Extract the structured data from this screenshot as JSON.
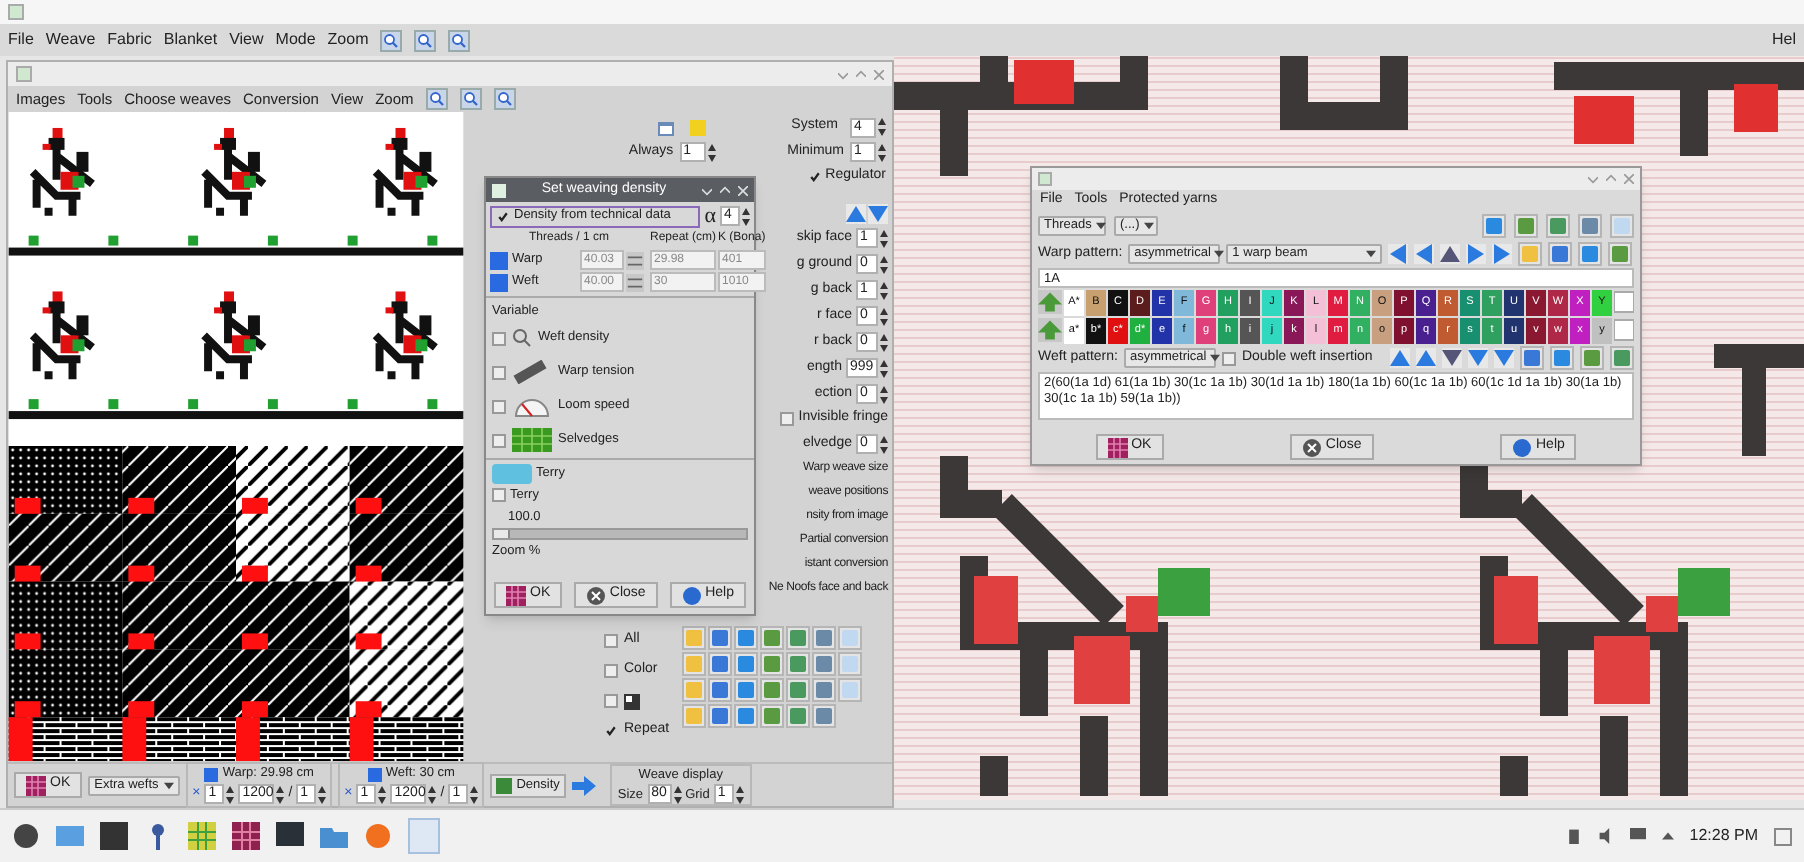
{
  "menu_bar": {
    "items": [
      "File",
      "Weave",
      "Fabric",
      "Blanket",
      "View",
      "Mode",
      "Zoom"
    ],
    "help": "Hel"
  },
  "main_window": {
    "menu": [
      "Images",
      "Tools",
      "Choose weaves",
      "Conversion",
      "View",
      "Zoom"
    ],
    "system": {
      "label": "System",
      "value": "4"
    },
    "always": {
      "label": "Always",
      "value": "1"
    },
    "minimum": {
      "label": "Minimum",
      "value": "1"
    },
    "regulator": {
      "label": "Regulator",
      "checked": true
    },
    "partial_fields": [
      {
        "label": "skip face",
        "value": "1"
      },
      {
        "label": "g ground",
        "value": "0"
      },
      {
        "label": "g back",
        "value": "1"
      },
      {
        "label": "r face",
        "value": "0"
      },
      {
        "label": "r back",
        "value": "0"
      },
      {
        "label": "ength",
        "value": "999"
      },
      {
        "label": "ection",
        "value": "0"
      }
    ],
    "invisible_fringe": {
      "label": "Invisible fringe",
      "checked": false
    },
    "selvedge": {
      "label": "elvedge",
      "value": "0"
    },
    "partial_buttons": [
      "Warp weave size",
      "weave positions",
      "nsity from image",
      "Partial conversion",
      "istant conversion",
      "Ne Noofs face and back"
    ],
    "options": [
      {
        "kind": "text",
        "label": "All",
        "checked": false
      },
      {
        "kind": "text",
        "label": "Color",
        "checked": false
      },
      {
        "kind": "icon",
        "checked": false
      },
      {
        "kind": "text",
        "label": "Repeat",
        "checked": true
      }
    ],
    "weave_display": {
      "title": "Weave display",
      "size_label": "Size",
      "size": "80",
      "grid_label": "Grid",
      "grid": "1"
    },
    "bottom_bar": {
      "ok": "OK",
      "extra_wefts": "Extra wefts",
      "density": "Density",
      "warp": {
        "label": "Warp: 29.98 cm",
        "times": "×",
        "multiplier": "1",
        "threads": "1200",
        "slash": "/",
        "divisor": "1"
      },
      "weft": {
        "label": "Weft: 30 cm",
        "times": "×",
        "multiplier": "1",
        "threads": "1200",
        "slash": "/",
        "divisor": "1"
      }
    }
  },
  "density_dialog": {
    "title": "Set weaving density",
    "from_technical": {
      "label": "Density from technical data",
      "checked": true
    },
    "alpha": "α",
    "alpha_value": "4",
    "headers": [
      "Threads / 1 cm",
      "Repeat (cm)",
      "K (Bona)"
    ],
    "rows": [
      {
        "label": "Warp",
        "density": "40.03",
        "repeat": "29.98",
        "k": "401"
      },
      {
        "label": "Weft",
        "density": "40.00",
        "repeat": "30",
        "k": "1010"
      }
    ],
    "variable_title": "Variable",
    "variables": [
      {
        "kind": "weft",
        "label": "Weft density",
        "checked": false
      },
      {
        "kind": "tension",
        "label": "Warp tension",
        "checked": false
      },
      {
        "kind": "speed",
        "label": "Loom speed",
        "checked": false
      },
      {
        "kind": "selvedge",
        "label": "Selvedges",
        "checked": false
      }
    ],
    "terry_title": "Terry",
    "terry": {
      "label": "Terry",
      "checked": false
    },
    "zoom_value": "100.0",
    "zoom_label": "Zoom %",
    "buttons": [
      "OK",
      "Close",
      "Help"
    ]
  },
  "yarn_dialog": {
    "menu": [
      "File",
      "Tools",
      "Protected yarns"
    ],
    "threads": "Threads",
    "threads_option": "(...)",
    "warp_label": "Warp pattern:",
    "warp_mode": "asymmetrical",
    "beam": "1 warp beam",
    "current": "1A",
    "warp_yarns": [
      {
        "letter": "A*",
        "color": "#ffffff"
      },
      {
        "letter": "B",
        "color": "#c8a070"
      },
      {
        "letter": "C",
        "color": "#111111"
      },
      {
        "letter": "D",
        "color": "#5a1c1c"
      },
      {
        "letter": "E",
        "color": "#2233aa"
      },
      {
        "letter": "F",
        "color": "#7fb8d8"
      },
      {
        "letter": "G",
        "color": "#e0407a"
      },
      {
        "letter": "H",
        "color": "#22a060"
      },
      {
        "letter": "I",
        "color": "#555555"
      },
      {
        "letter": "J",
        "color": "#30d8c0"
      },
      {
        "letter": "K",
        "color": "#8a1858"
      },
      {
        "letter": "L",
        "color": "#f4c0d8"
      },
      {
        "letter": "M",
        "color": "#e01c40"
      },
      {
        "letter": "N",
        "color": "#30b060"
      },
      {
        "letter": "O",
        "color": "#c8a080"
      },
      {
        "letter": "P",
        "color": "#801030"
      },
      {
        "letter": "Q",
        "color": "#4a2090"
      },
      {
        "letter": "R",
        "color": "#c05a30"
      },
      {
        "letter": "S",
        "color": "#189070"
      },
      {
        "letter": "T",
        "color": "#30a060"
      },
      {
        "letter": "U",
        "color": "#223470"
      },
      {
        "letter": "V",
        "color": "#8a1830"
      },
      {
        "letter": "W",
        "color": "#b02848"
      },
      {
        "letter": "X",
        "color": "#c020c0"
      },
      {
        "letter": "Y",
        "color": "#30d040"
      }
    ],
    "weft_yarns": [
      {
        "letter": "a*",
        "color": "#ffffff"
      },
      {
        "letter": "b*",
        "color": "#111111"
      },
      {
        "letter": "c*",
        "color": "#e01010"
      },
      {
        "letter": "d*",
        "color": "#20b040"
      },
      {
        "letter": "e",
        "color": "#2233aa"
      },
      {
        "letter": "f",
        "color": "#7fb8d8"
      },
      {
        "letter": "g",
        "color": "#e0407a"
      },
      {
        "letter": "h",
        "color": "#22a060"
      },
      {
        "letter": "i",
        "color": "#555555"
      },
      {
        "letter": "j",
        "color": "#30d8c0"
      },
      {
        "letter": "k",
        "color": "#8a1858"
      },
      {
        "letter": "l",
        "color": "#f4c0d8"
      },
      {
        "letter": "m",
        "color": "#e01c40"
      },
      {
        "letter": "n",
        "color": "#30b060"
      },
      {
        "letter": "o",
        "color": "#c8a080"
      },
      {
        "letter": "p",
        "color": "#801030"
      },
      {
        "letter": "q",
        "color": "#4a2090"
      },
      {
        "letter": "r",
        "color": "#c05a30"
      },
      {
        "letter": "s",
        "color": "#189070"
      },
      {
        "letter": "t",
        "color": "#30a060"
      },
      {
        "letter": "u",
        "color": "#223470"
      },
      {
        "letter": "v",
        "color": "#8a1830"
      },
      {
        "letter": "w",
        "color": "#b02848"
      },
      {
        "letter": "x",
        "color": "#c020c0"
      },
      {
        "letter": "y",
        "color": "#c0c0c0"
      }
    ],
    "weft_label": "Weft pattern:",
    "weft_mode": "asymmetrical",
    "double_weft": {
      "label": "Double weft insertion",
      "checked": false
    },
    "pattern": "2(60(1a 1d) 61(1a 1b) 30(1c 1a 1b) 30(1d 1a 1b) 180(1a 1b) 60(1c 1a 1b) 60(1c 1d 1a 1b) 30(1a 1b) 30(1c 1a 1b) 59(1a 1b))",
    "buttons": [
      "OK",
      "Close",
      "Help"
    ]
  },
  "taskbar": {
    "clock": "12:28 PM"
  }
}
